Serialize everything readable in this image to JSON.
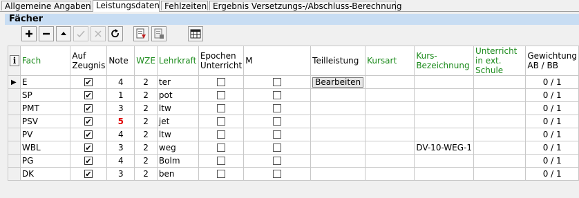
{
  "tabs": [
    {
      "label": "Allgemeine Angaben",
      "active": false
    },
    {
      "label": "Leistungsdaten",
      "active": true
    },
    {
      "label": "Fehlzeiten",
      "active": false
    },
    {
      "label": "Ergebnis Versetzungs-/Abschluss-Berechnung",
      "active": false
    }
  ],
  "section": {
    "title": "Fächer"
  },
  "toolbar": {
    "buttons": [
      "plus-icon",
      "minus-icon",
      "up-arrow-icon",
      "check-icon",
      "cross-icon",
      "refresh-icon",
      "import-icon",
      "export-icon",
      "settings-grid-icon"
    ]
  },
  "table": {
    "info_label": "i",
    "headers": {
      "fach": "Fach",
      "zeugnis": "Auf Zeugnis",
      "note": "Note",
      "wze": "WZE",
      "lehrkraft": "Lehrkraft",
      "epochen": "Epochen Unterricht",
      "m": "M",
      "teilleistung": "Teilleistung",
      "kursart": "Kursart",
      "kurs": "Kurs-Bezeichnung",
      "extschule": "Unterricht in ext. Schule",
      "gewichtung": "Gewichtung AB / BB"
    },
    "edit_label": "Bearbeiten",
    "rows": [
      {
        "fach": "E",
        "zeugnis": true,
        "note": "4",
        "note_red": false,
        "wze": "2",
        "lehrkraft": "ter",
        "epochen": false,
        "m": false,
        "kurs": "",
        "gewichtung": "0 / 1",
        "selected": true
      },
      {
        "fach": "SP",
        "zeugnis": true,
        "note": "1",
        "note_red": false,
        "wze": "2",
        "lehrkraft": "pot",
        "epochen": false,
        "m": false,
        "kurs": "",
        "gewichtung": "0 / 1",
        "selected": false
      },
      {
        "fach": "PMT",
        "zeugnis": true,
        "note": "3",
        "note_red": false,
        "wze": "2",
        "lehrkraft": "ltw",
        "epochen": false,
        "m": false,
        "kurs": "",
        "gewichtung": "0 / 1",
        "selected": false
      },
      {
        "fach": "PSV",
        "zeugnis": true,
        "note": "5",
        "note_red": true,
        "wze": "2",
        "lehrkraft": "jet",
        "epochen": false,
        "m": false,
        "kurs": "",
        "gewichtung": "0 / 1",
        "selected": false
      },
      {
        "fach": "PV",
        "zeugnis": true,
        "note": "4",
        "note_red": false,
        "wze": "2",
        "lehrkraft": "ltw",
        "epochen": false,
        "m": false,
        "kurs": "",
        "gewichtung": "0 / 1",
        "selected": false
      },
      {
        "fach": "WBL",
        "zeugnis": true,
        "note": "3",
        "note_red": false,
        "wze": "2",
        "lehrkraft": "weg",
        "epochen": false,
        "m": false,
        "kurs": "DV-10-WEG-1",
        "gewichtung": "0 / 1",
        "selected": false
      },
      {
        "fach": "PG",
        "zeugnis": true,
        "note": "4",
        "note_red": false,
        "wze": "2",
        "lehrkraft": "Bolm",
        "epochen": false,
        "m": false,
        "kurs": "",
        "gewichtung": "0 / 1",
        "selected": false
      },
      {
        "fach": "DK",
        "zeugnis": true,
        "note": "3",
        "note_red": false,
        "wze": "2",
        "lehrkraft": "ben",
        "epochen": false,
        "m": false,
        "kurs": "",
        "gewichtung": "0 / 1",
        "selected": false
      }
    ]
  },
  "colors": {
    "note_alert": "#e00000",
    "green_header": "#1a8a1a",
    "section_bg": "#c8ddf3"
  }
}
